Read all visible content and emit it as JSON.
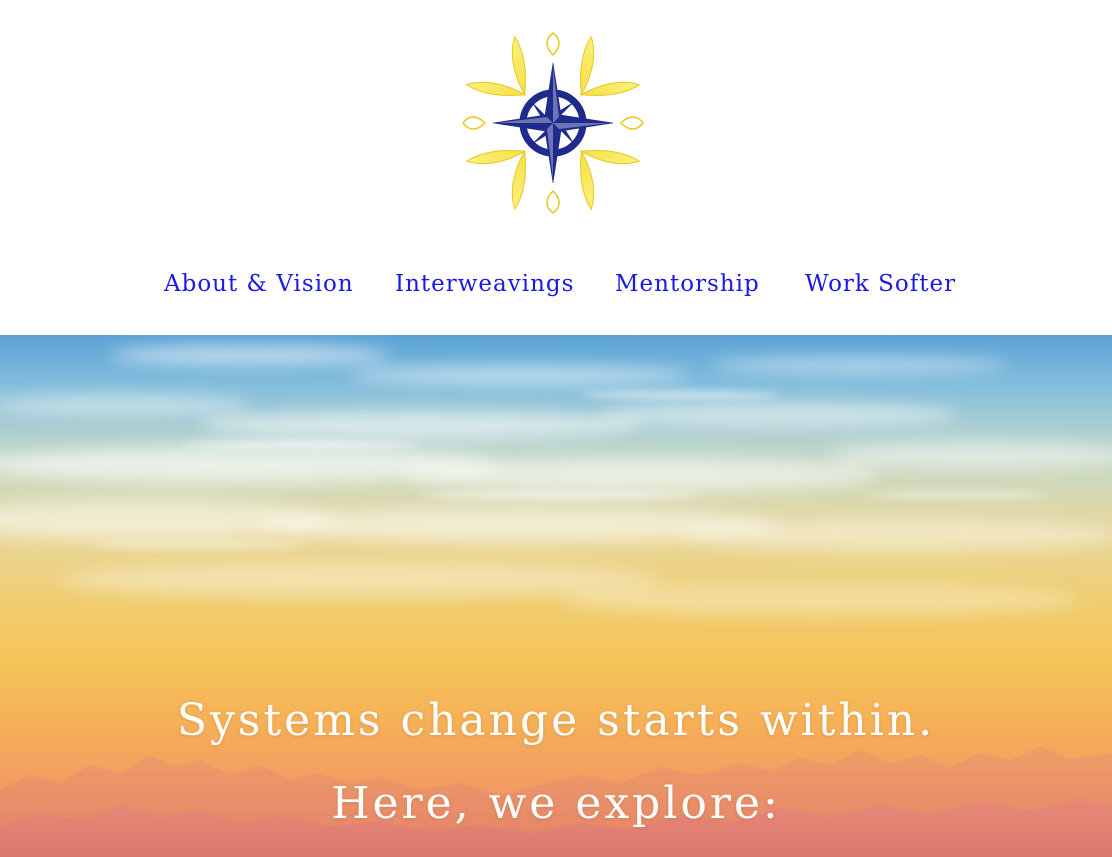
{
  "brand": {
    "logo_icon": "compass-sun-icon",
    "colors": {
      "petal": "#f5e04a",
      "petal_outline": "#e8c81a",
      "compass": "#1f2a8c"
    }
  },
  "nav": {
    "items": [
      {
        "label": "About & Vision"
      },
      {
        "label": "Interweavings"
      },
      {
        "label": "Mentorship"
      },
      {
        "label": "Work Softer"
      }
    ],
    "link_color": "#1a1ae0"
  },
  "hero": {
    "headline": "Systems change starts within.",
    "subheadline": "Here, we explore:",
    "text_color": "#ffffff"
  }
}
